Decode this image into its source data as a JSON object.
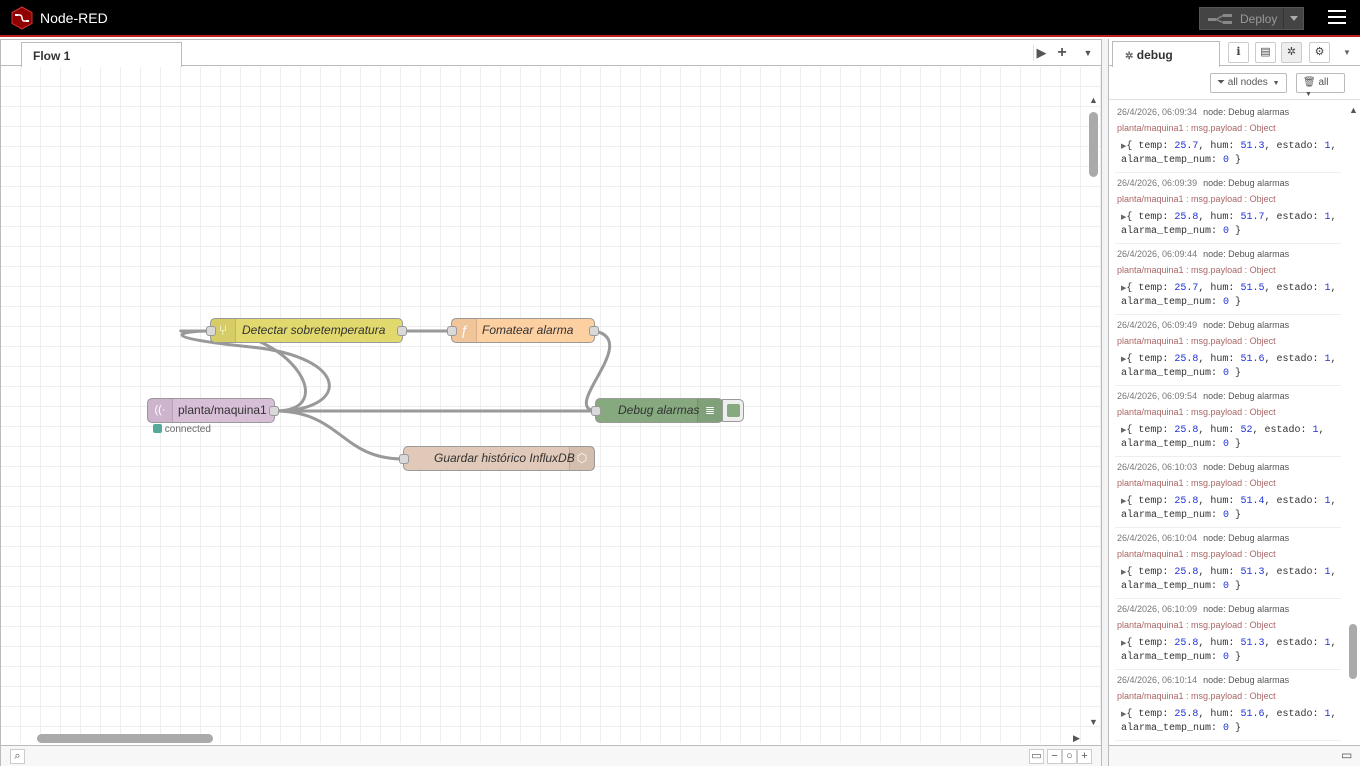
{
  "app": {
    "title": "Node-RED"
  },
  "header": {
    "deploy_label": "Deploy"
  },
  "workspace": {
    "tabs": [
      {
        "label": "Flow 1"
      }
    ]
  },
  "flow": {
    "nodes": {
      "switch": {
        "label": "Detectar sobretemperatura",
        "color": "#e2d96e"
      },
      "function": {
        "label": "Fomatear alarma",
        "color": "#fdd0a2"
      },
      "mqtt": {
        "label": "planta/maquina1",
        "color": "#d8bfd8",
        "status": "connected",
        "status_color": "#5a9"
      },
      "debug": {
        "label": "Debug alarmas",
        "color": "#87a980"
      },
      "influx": {
        "label": "Guardar histórico InfluxDB",
        "color": "#e0c9b8"
      }
    }
  },
  "sidebar": {
    "tab_label": "debug",
    "filter_label": "all nodes",
    "clear_label": "all",
    "messages": [
      {
        "time": "26/4/2026, 06:09:34",
        "node": "node: Debug alarmas",
        "topic": "planta/maquina1 : msg.payload : Object",
        "temp": "25.7",
        "hum": "51.3",
        "estado": "1",
        "alarma": "0"
      },
      {
        "time": "26/4/2026, 06:09:39",
        "node": "node: Debug alarmas",
        "topic": "planta/maquina1 : msg.payload : Object",
        "temp": "25.8",
        "hum": "51.7",
        "estado": "1",
        "alarma": "0"
      },
      {
        "time": "26/4/2026, 06:09:44",
        "node": "node: Debug alarmas",
        "topic": "planta/maquina1 : msg.payload : Object",
        "temp": "25.7",
        "hum": "51.5",
        "estado": "1",
        "alarma": "0"
      },
      {
        "time": "26/4/2026, 06:09:49",
        "node": "node: Debug alarmas",
        "topic": "planta/maquina1 : msg.payload : Object",
        "temp": "25.8",
        "hum": "51.6",
        "estado": "1",
        "alarma": "0"
      },
      {
        "time": "26/4/2026, 06:09:54",
        "node": "node: Debug alarmas",
        "topic": "planta/maquina1 : msg.payload : Object",
        "temp": "25.8",
        "hum": "52",
        "estado": "1",
        "alarma": "0"
      },
      {
        "time": "26/4/2026, 06:10:03",
        "node": "node: Debug alarmas",
        "topic": "planta/maquina1 : msg.payload : Object",
        "temp": "25.8",
        "hum": "51.4",
        "estado": "1",
        "alarma": "0"
      },
      {
        "time": "26/4/2026, 06:10:04",
        "node": "node: Debug alarmas",
        "topic": "planta/maquina1 : msg.payload : Object",
        "temp": "25.8",
        "hum": "51.3",
        "estado": "1",
        "alarma": "0"
      },
      {
        "time": "26/4/2026, 06:10:09",
        "node": "node: Debug alarmas",
        "topic": "planta/maquina1 : msg.payload : Object",
        "temp": "25.8",
        "hum": "51.3",
        "estado": "1",
        "alarma": "0"
      },
      {
        "time": "26/4/2026, 06:10:14",
        "node": "node: Debug alarmas",
        "topic": "planta/maquina1 : msg.payload : Object",
        "temp": "25.8",
        "hum": "51.6",
        "estado": "1",
        "alarma": "0"
      }
    ]
  }
}
